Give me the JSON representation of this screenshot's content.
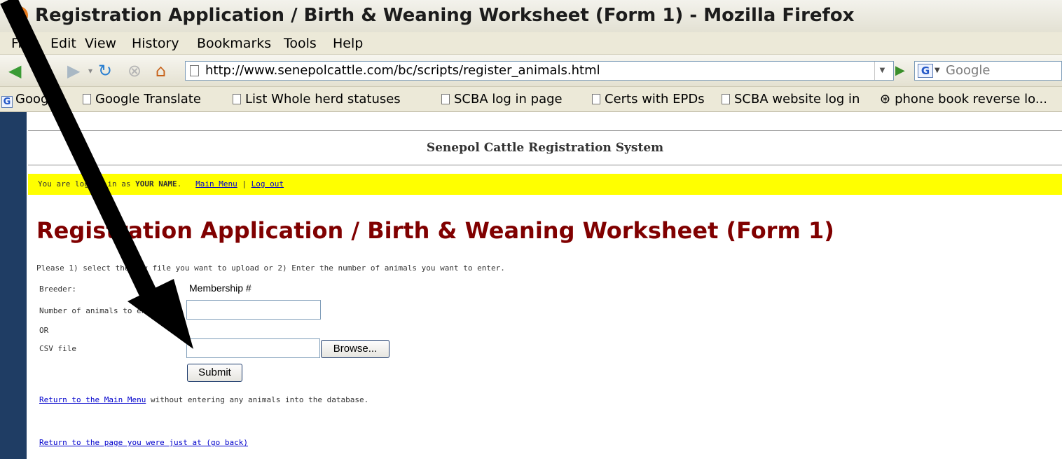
{
  "window": {
    "title": "Registration Application / Birth & Weaning Worksheet (Form 1) - Mozilla Firefox"
  },
  "menu": [
    "File",
    "Edit",
    "View",
    "History",
    "Bookmarks",
    "Tools",
    "Help"
  ],
  "nav": {
    "url": "http://www.senepolcattle.com/bc/scripts/register_animals.html",
    "search_placeholder": "Google",
    "icons": [
      "back-icon",
      "forward-icon",
      "reload-icon",
      "stop-icon",
      "home-icon"
    ]
  },
  "bookmarks": [
    {
      "label": "Google",
      "icon": "google-icon"
    },
    {
      "label": "Google Translate",
      "icon": "page-icon"
    },
    {
      "label": "List Whole herd statuses",
      "icon": "page-icon"
    },
    {
      "label": "SCBA log in page",
      "icon": "page-icon"
    },
    {
      "label": "Certs with EPDs",
      "icon": "page-icon"
    },
    {
      "label": "SCBA website log in",
      "icon": "page-icon"
    },
    {
      "label": "phone book reverse lo...",
      "icon": "globe-icon"
    }
  ],
  "page": {
    "site_title": "Senepol Cattle Registration System",
    "login": {
      "prefix": "You are logged in as",
      "user": "YOUR NAME",
      "main_menu": "Main Menu",
      "separator": "|",
      "log_out": "Log out"
    },
    "heading": "Registration Application / Birth & Weaning Worksheet (Form 1)",
    "instructions": "Please 1) select the csv file you want to upload or 2) Enter the number of animals you want to enter.",
    "form": {
      "breeder_label": "Breeder:",
      "membership_label": "Membership #",
      "animals_label": "Number of animals to enter",
      "or_label": "OR",
      "csv_label": "CSV file",
      "browse_label": "Browse...",
      "submit_label": "Submit",
      "animals_value": "",
      "csv_value": ""
    },
    "links": {
      "main_menu_link": "Return to the Main Menu",
      "main_menu_suffix": " without entering any animals into the database.",
      "go_back_link": "Return to the page you were just at (go back)"
    }
  },
  "colors": {
    "heading": "#800000",
    "login_bar": "#ffff00",
    "annotation_arrow": "#000000"
  }
}
